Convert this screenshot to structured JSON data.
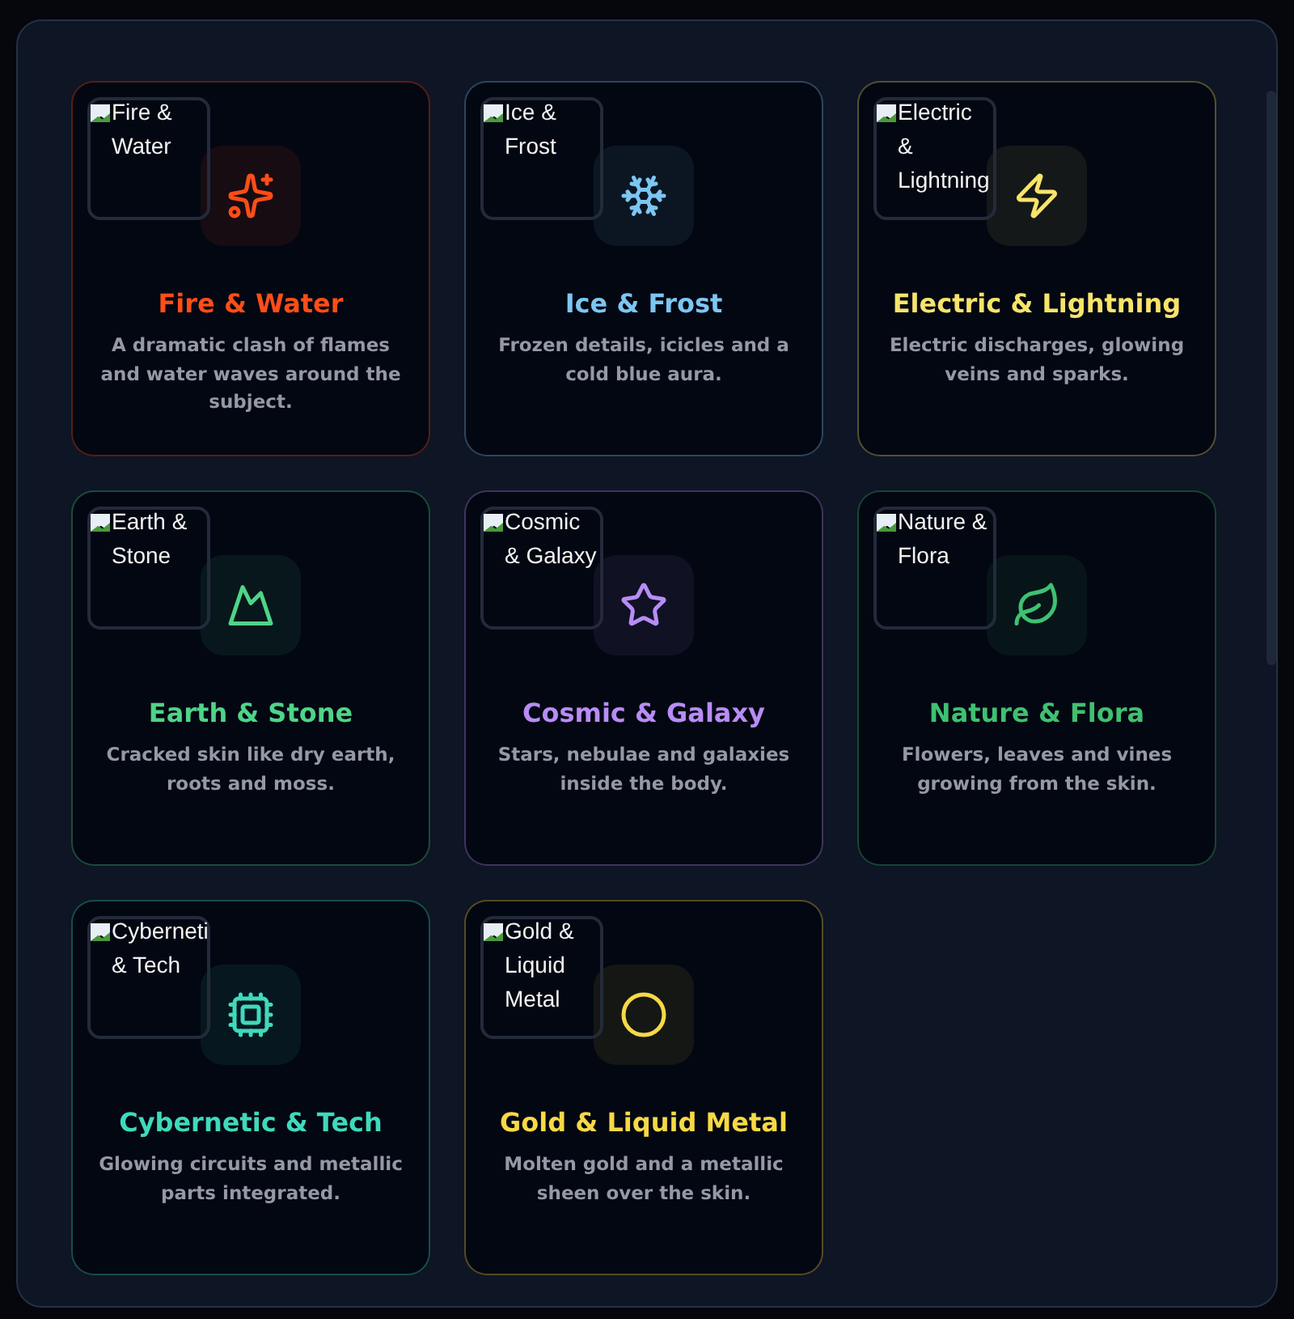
{
  "styles": [
    {
      "title": "Fire & Water",
      "description": "A dramatic clash of flames and water waves around the subject.",
      "image_alt": "Fire & Water",
      "color": "#ff4d17"
    },
    {
      "title": "Ice & Frost",
      "description": "Frozen details, icicles and a cold blue aura.",
      "image_alt": "Ice & Frost",
      "color": "#7cc6f2"
    },
    {
      "title": "Electric & Lightning",
      "description": "Electric discharges, glowing veins and sparks.",
      "image_alt": "Electric & Lightning",
      "color": "#f7e46a"
    },
    {
      "title": "Earth & Stone",
      "description": "Cracked skin like dry earth, roots and moss.",
      "image_alt": "Earth & Stone",
      "color": "#4fd487"
    },
    {
      "title": "Cosmic & Galaxy",
      "description": "Stars, nebulae and galaxies inside the body.",
      "image_alt": "Cosmic & Galaxy",
      "color": "#b88cf5"
    },
    {
      "title": "Nature & Flora",
      "description": "Flowers, leaves and vines growing from the skin.",
      "image_alt": "Nature & Flora",
      "color": "#3fc170"
    },
    {
      "title": "Cybernetic & Tech",
      "description": "Glowing circuits and metallic parts integrated.",
      "image_alt": "Cyberneti & Tech",
      "color": "#3fd9bb"
    },
    {
      "title": "Gold & Liquid Metal",
      "description": "Molten gold and a metallic sheen over the skin.",
      "image_alt": "Gold & Liquid Metal",
      "color": "#f7d945"
    }
  ]
}
